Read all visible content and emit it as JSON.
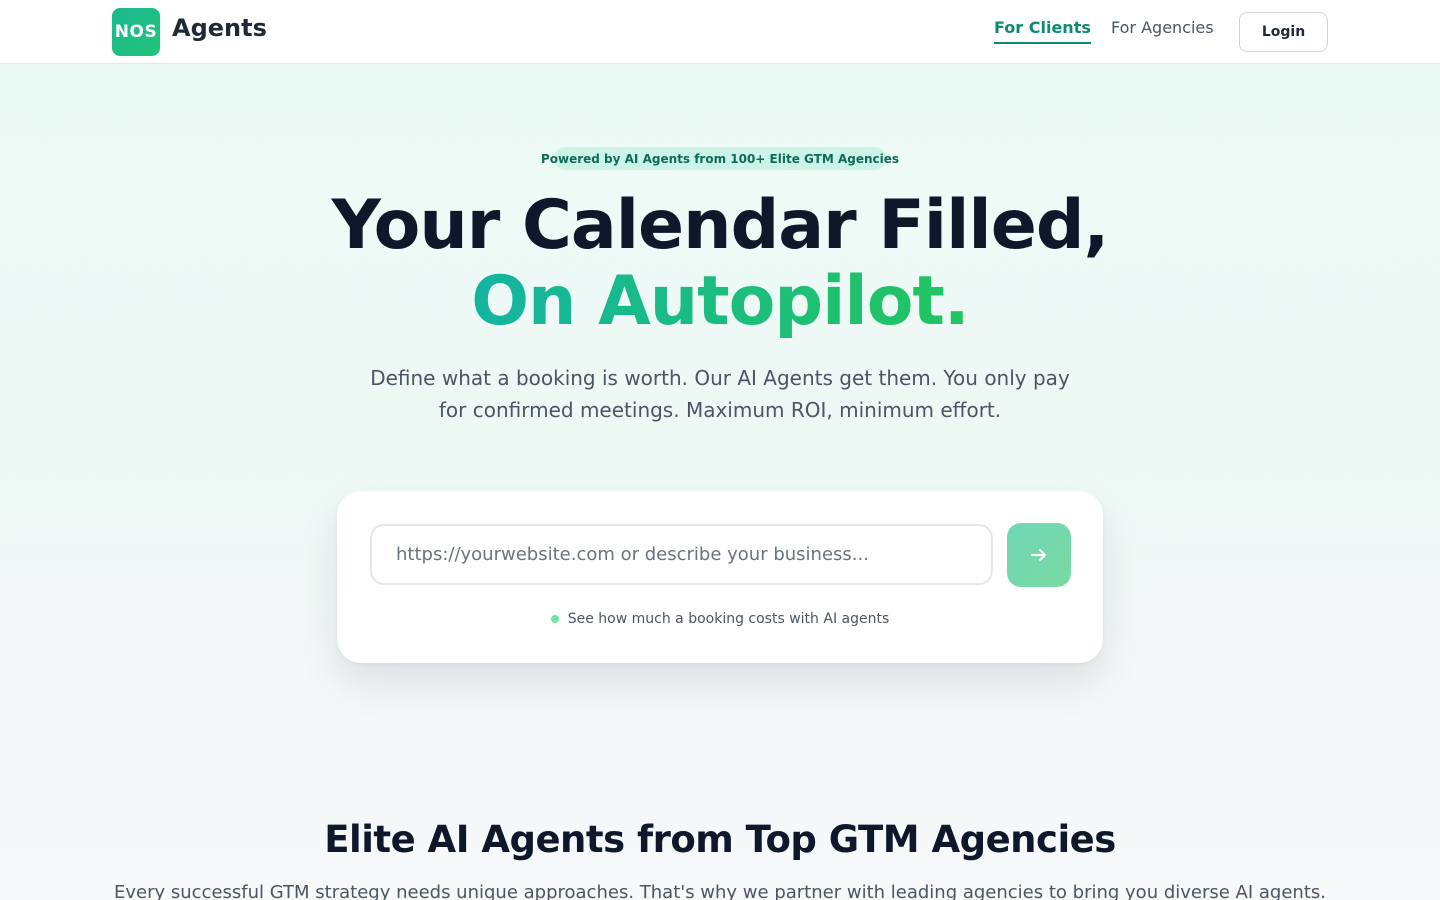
{
  "header": {
    "logo_badge": "NOS",
    "logo_text": "Agents",
    "nav": [
      {
        "label": "For Clients",
        "active": true
      },
      {
        "label": "For Agencies",
        "active": false
      }
    ],
    "login_label": "Login"
  },
  "hero": {
    "pill": "Powered by AI Agents from 100+ Elite GTM Agencies",
    "title_line1": "Your Calendar Filled,",
    "title_line2": "On Autopilot.",
    "subtitle": "Define what a booking is worth. Our AI Agents get them. You only pay for confirmed meetings. Maximum ROI, minimum effort."
  },
  "search": {
    "value": "",
    "placeholder": "https://yourwebsite.com or describe your business...",
    "submit_icon": "arrow-right-icon",
    "hint": "See how much a booking costs with AI agents"
  },
  "section": {
    "title": "Elite AI Agents from Top GTM Agencies",
    "subtitle": "Every successful GTM strategy needs unique approaches. That's why we partner with leading agencies to bring you diverse AI agents."
  },
  "colors": {
    "accent": "#0f8a72",
    "gradient_start": "#14b4a0",
    "gradient_end": "#22c55e",
    "pill_bg": "#cdf3e6"
  }
}
